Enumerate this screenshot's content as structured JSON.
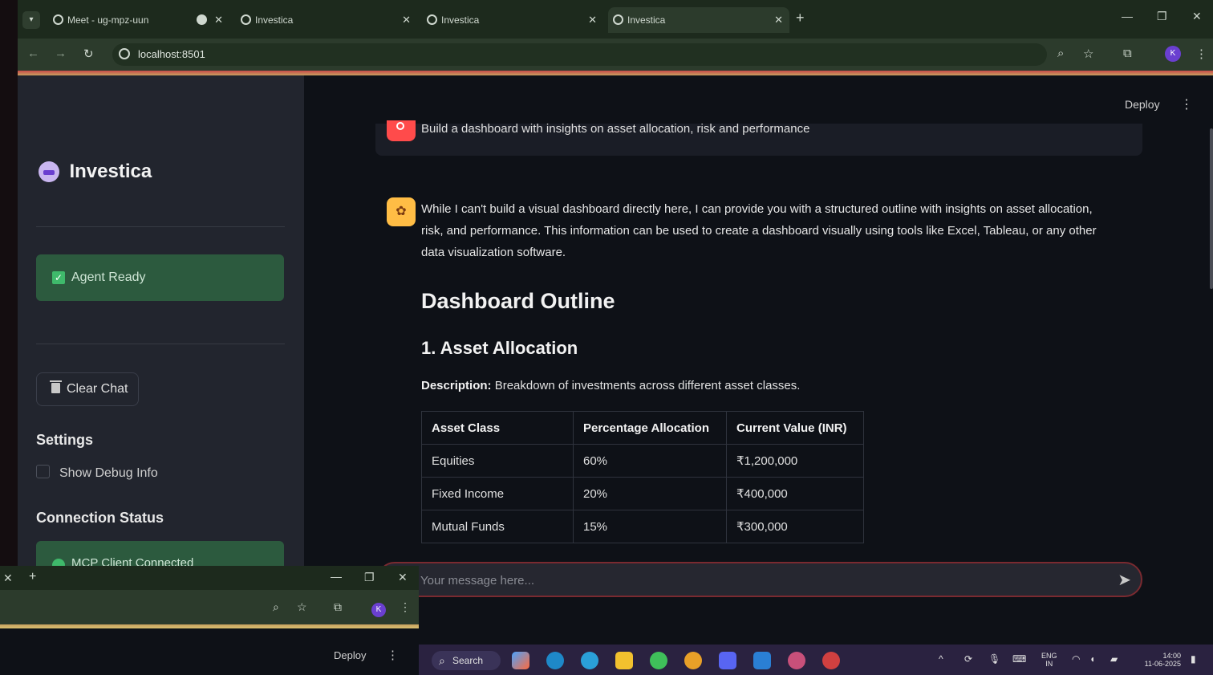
{
  "browser": {
    "tabs": [
      {
        "title": "Meet - ug-mpz-uun"
      },
      {
        "title": "Investica"
      },
      {
        "title": "Investica"
      },
      {
        "title": "Investica"
      }
    ],
    "url": "localhost:8501",
    "profile_initial": "K"
  },
  "sidebar": {
    "app_title": "Investica",
    "agent_status": "Agent Ready",
    "clear_chat": "Clear Chat",
    "settings_heading": "Settings",
    "debug_label": "Show Debug Info",
    "connection_heading": "Connection Status",
    "mcp_status": "MCP Client Connected"
  },
  "main": {
    "deploy_label": "Deploy",
    "user_message": "Build a dashboard with insights on asset allocation, risk and performance",
    "assistant_intro": "While I can't build a visual dashboard directly here, I can provide you with a structured outline with insights on asset allocation, risk, and performance. This information can be used to create a dashboard visually using tools like Excel, Tableau, or any other data visualization software.",
    "heading": "Dashboard Outline",
    "section_heading": "1. Asset Allocation",
    "description_label": "Description:",
    "description_text": "Breakdown of investments across different asset classes.",
    "table": {
      "headers": [
        "Asset Class",
        "Percentage Allocation",
        "Current Value (INR)"
      ],
      "rows": [
        [
          "Equities",
          "60%",
          "₹1,200,000"
        ],
        [
          "Fixed Income",
          "20%",
          "₹400,000"
        ],
        [
          "Mutual Funds",
          "15%",
          "₹300,000"
        ]
      ]
    },
    "input_placeholder": "Your message here..."
  },
  "overlay_window": {
    "deploy_label": "Deploy"
  },
  "taskbar": {
    "search_label": "Search",
    "lang_top": "ENG",
    "lang_bottom": "IN",
    "time": "14:00",
    "date": "11-06-2025"
  },
  "colors": {
    "sidebar_bg": "#22252e",
    "main_bg": "#0e1117",
    "status_green": "#2c5a3e",
    "user_avatar": "#ff4b4b",
    "bot_avatar": "#ffbd45"
  }
}
